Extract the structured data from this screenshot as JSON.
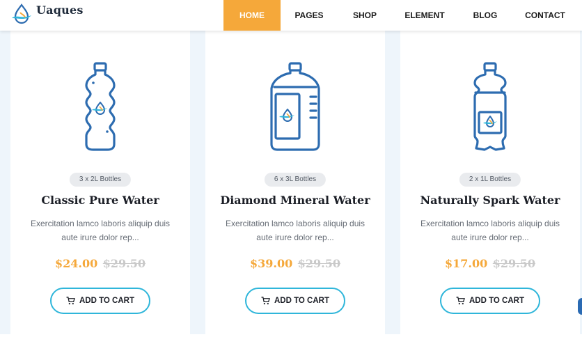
{
  "brand": {
    "name": "Uaques"
  },
  "nav": {
    "items": [
      {
        "label": "HOME",
        "active": true
      },
      {
        "label": "PAGES",
        "active": false
      },
      {
        "label": "SHOP",
        "active": false
      },
      {
        "label": "ELEMENT",
        "active": false
      },
      {
        "label": "BLOG",
        "active": false
      },
      {
        "label": "CONTACT",
        "active": false
      }
    ]
  },
  "products": [
    {
      "badge": "3 x 2L Bottles",
      "title": "Classic Pure Water",
      "description": "Exercitation lamco laboris aliquip duis aute irure dolor rep...",
      "price": "$24.00",
      "old_price": "$29.50",
      "button": "ADD TO CART",
      "icon": "small-bottle-icon"
    },
    {
      "badge": "6 x 3L Bottles",
      "title": "Diamond Mineral Water",
      "description": "Exercitation lamco laboris aliquip duis aute irure dolor rep...",
      "price": "$39.00",
      "old_price": "$29.50",
      "button": "ADD TO CART",
      "icon": "large-jug-icon"
    },
    {
      "badge": "2 x 1L Bottles",
      "title": "Naturally Spark Water",
      "description": "Exercitation lamco laboris aliquip duis aute irure dolor rep...",
      "price": "$17.00",
      "old_price": "$29.50",
      "button": "ADD TO CART",
      "icon": "soda-bottle-icon"
    }
  ],
  "colors": {
    "accent": "#f5a83a",
    "brand_blue": "#2d6cb0",
    "button_border": "#2fb6da",
    "background": "#eef5fb"
  }
}
